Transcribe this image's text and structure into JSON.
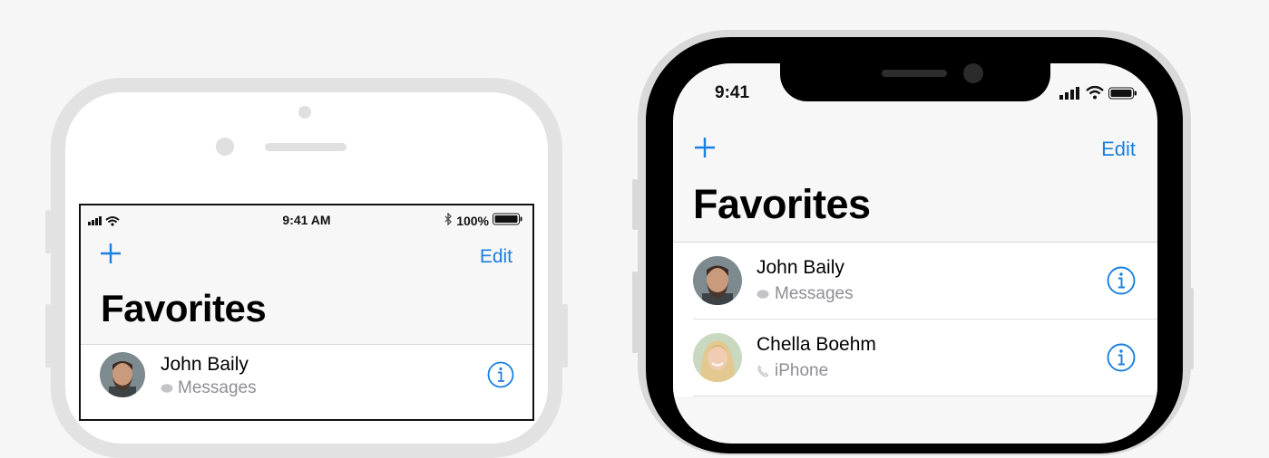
{
  "colors": {
    "accent": "#1a7fe0",
    "secondary_text": "#8e8e93"
  },
  "left_phone": {
    "status_bar": {
      "time": "9:41 AM",
      "battery": "100%"
    },
    "edit_label": "Edit",
    "title": "Favorites",
    "contacts": [
      {
        "name": "John Baily",
        "method": "Messages",
        "method_icon": "message-icon"
      }
    ]
  },
  "right_phone": {
    "status_bar": {
      "time": "9:41"
    },
    "edit_label": "Edit",
    "title": "Favorites",
    "contacts": [
      {
        "name": "John Baily",
        "method": "Messages",
        "method_icon": "message-icon"
      },
      {
        "name": "Chella Boehm",
        "method": "iPhone",
        "method_icon": "phone-icon"
      }
    ]
  }
}
